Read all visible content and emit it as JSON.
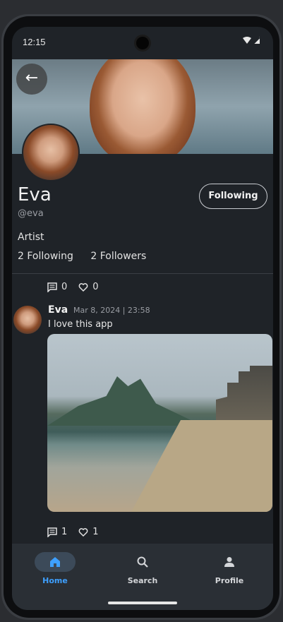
{
  "status": {
    "time": "12:15"
  },
  "profile": {
    "name": "Eva",
    "handle": "@eva",
    "follow_button": "Following",
    "bio": "Artist",
    "following_count": "2 Following",
    "followers_count": "2 Followers"
  },
  "top_actions": {
    "comments": "0",
    "likes": "0"
  },
  "post": {
    "author": "Eva",
    "date": "Mar 8, 2024 | 23:58",
    "text": "I love this app",
    "comments": "1",
    "likes": "1"
  },
  "nav": {
    "home": "Home",
    "search": "Search",
    "profile": "Profile"
  },
  "colors": {
    "accent": "#3ea0ff",
    "background": "#1f2328"
  }
}
